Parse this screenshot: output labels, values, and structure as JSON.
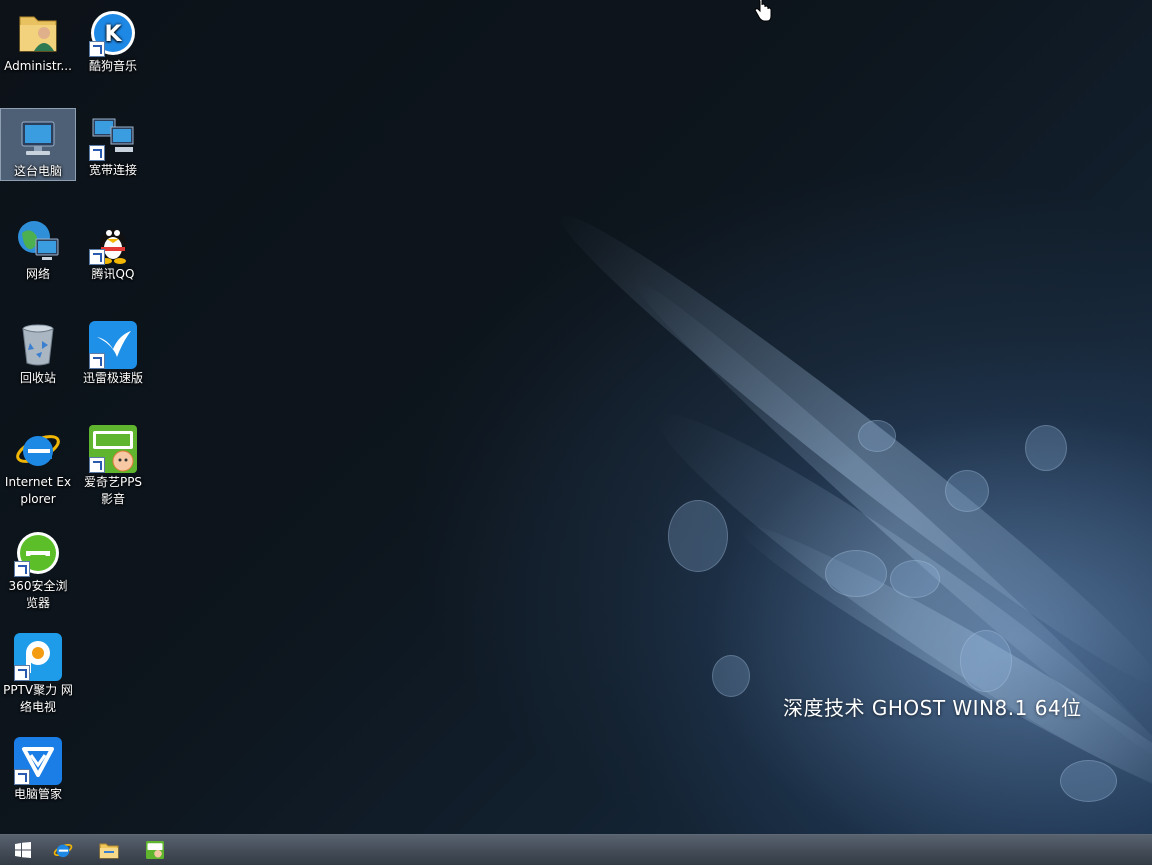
{
  "desktop": {
    "watermark": "深度技术  GHOST  WIN8.1  64位",
    "icons": [
      {
        "label": "Administr...",
        "icon": "user-folder-icon"
      },
      {
        "label": "酷狗音乐",
        "icon": "kugou-music-icon"
      },
      {
        "label": "这台电脑",
        "icon": "computer-icon"
      },
      {
        "label": "宽带连接",
        "icon": "broadband-connection-icon"
      },
      {
        "label": "网络",
        "icon": "network-icon"
      },
      {
        "label": "腾讯QQ",
        "icon": "qq-icon"
      },
      {
        "label": "回收站",
        "icon": "recycle-bin-icon"
      },
      {
        "label": "迅雷极速版",
        "icon": "xunlei-icon"
      },
      {
        "label": "Internet Explorer",
        "icon": "internet-explorer-icon"
      },
      {
        "label": "爱奇艺PPS 影音",
        "icon": "iqiyi-pps-icon"
      },
      {
        "label": "360安全浏览器",
        "icon": "360-browser-icon"
      },
      {
        "label": "PPTV聚力 网络电视",
        "icon": "pptv-icon"
      },
      {
        "label": "电脑管家",
        "icon": "tencent-pc-manager-icon"
      }
    ]
  },
  "taskbar": {
    "items": [
      {
        "icon": "windows-start-icon"
      },
      {
        "icon": "internet-explorer-icon"
      },
      {
        "icon": "file-explorer-icon"
      },
      {
        "icon": "iqiyi-pps-icon"
      }
    ]
  },
  "colors": {
    "taskbar": "#2f3742",
    "selection": "#a0bee6",
    "accent_blue": "#1e88e5"
  }
}
